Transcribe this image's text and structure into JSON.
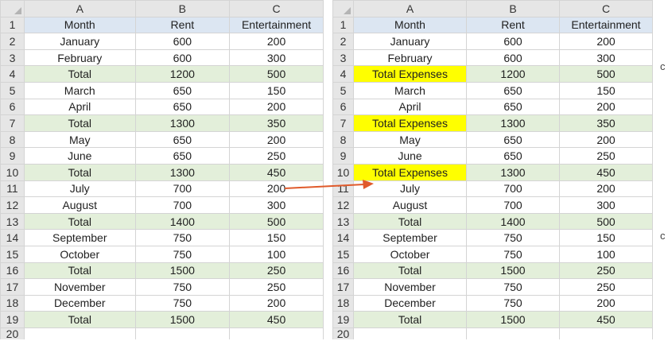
{
  "columns": [
    "A",
    "B",
    "C"
  ],
  "left_sheet": {
    "rows": [
      {
        "num": "1",
        "a": "Month",
        "b": "Rent",
        "c": "Entertainment",
        "kind": "header"
      },
      {
        "num": "2",
        "a": "January",
        "b": "600",
        "c": "200",
        "kind": "data"
      },
      {
        "num": "3",
        "a": "February",
        "b": "600",
        "c": "300",
        "kind": "data"
      },
      {
        "num": "4",
        "a": "Total",
        "b": "1200",
        "c": "500",
        "kind": "total"
      },
      {
        "num": "5",
        "a": "March",
        "b": "650",
        "c": "150",
        "kind": "data"
      },
      {
        "num": "6",
        "a": "April",
        "b": "650",
        "c": "200",
        "kind": "data"
      },
      {
        "num": "7",
        "a": "Total",
        "b": "1300",
        "c": "350",
        "kind": "total"
      },
      {
        "num": "8",
        "a": "May",
        "b": "650",
        "c": "200",
        "kind": "data"
      },
      {
        "num": "9",
        "a": "June",
        "b": "650",
        "c": "250",
        "kind": "data"
      },
      {
        "num": "10",
        "a": "Total",
        "b": "1300",
        "c": "450",
        "kind": "total"
      },
      {
        "num": "11",
        "a": "July",
        "b": "700",
        "c": "200",
        "kind": "data"
      },
      {
        "num": "12",
        "a": "August",
        "b": "700",
        "c": "300",
        "kind": "data"
      },
      {
        "num": "13",
        "a": "Total",
        "b": "1400",
        "c": "500",
        "kind": "total"
      },
      {
        "num": "14",
        "a": "September",
        "b": "750",
        "c": "150",
        "kind": "data"
      },
      {
        "num": "15",
        "a": "October",
        "b": "750",
        "c": "100",
        "kind": "data"
      },
      {
        "num": "16",
        "a": "Total",
        "b": "1500",
        "c": "250",
        "kind": "total"
      },
      {
        "num": "17",
        "a": "November",
        "b": "750",
        "c": "250",
        "kind": "data"
      },
      {
        "num": "18",
        "a": "December",
        "b": "750",
        "c": "200",
        "kind": "data"
      },
      {
        "num": "19",
        "a": "Total",
        "b": "1500",
        "c": "450",
        "kind": "total"
      }
    ],
    "partial_row": "20"
  },
  "right_sheet": {
    "rows": [
      {
        "num": "1",
        "a": "Month",
        "b": "Rent",
        "c": "Entertainment",
        "kind": "header"
      },
      {
        "num": "2",
        "a": "January",
        "b": "600",
        "c": "200",
        "kind": "data"
      },
      {
        "num": "3",
        "a": "February",
        "b": "600",
        "c": "300",
        "kind": "data"
      },
      {
        "num": "4",
        "a": "Total Expenses",
        "b": "1200",
        "c": "500",
        "kind": "total",
        "highlight": true
      },
      {
        "num": "5",
        "a": "March",
        "b": "650",
        "c": "150",
        "kind": "data"
      },
      {
        "num": "6",
        "a": "April",
        "b": "650",
        "c": "200",
        "kind": "data"
      },
      {
        "num": "7",
        "a": "Total Expenses",
        "b": "1300",
        "c": "350",
        "kind": "total",
        "highlight": true
      },
      {
        "num": "8",
        "a": "May",
        "b": "650",
        "c": "200",
        "kind": "data"
      },
      {
        "num": "9",
        "a": "June",
        "b": "650",
        "c": "250",
        "kind": "data"
      },
      {
        "num": "10",
        "a": "Total Expenses",
        "b": "1300",
        "c": "450",
        "kind": "total",
        "highlight": true
      },
      {
        "num": "11",
        "a": "July",
        "b": "700",
        "c": "200",
        "kind": "data"
      },
      {
        "num": "12",
        "a": "August",
        "b": "700",
        "c": "300",
        "kind": "data"
      },
      {
        "num": "13",
        "a": "Total",
        "b": "1400",
        "c": "500",
        "kind": "total"
      },
      {
        "num": "14",
        "a": "September",
        "b": "750",
        "c": "150",
        "kind": "data"
      },
      {
        "num": "15",
        "a": "October",
        "b": "750",
        "c": "100",
        "kind": "data"
      },
      {
        "num": "16",
        "a": "Total",
        "b": "1500",
        "c": "250",
        "kind": "total"
      },
      {
        "num": "17",
        "a": "November",
        "b": "750",
        "c": "250",
        "kind": "data"
      },
      {
        "num": "18",
        "a": "December",
        "b": "750",
        "c": "200",
        "kind": "data"
      },
      {
        "num": "19",
        "a": "Total",
        "b": "1500",
        "c": "450",
        "kind": "total"
      }
    ],
    "partial_row": "20"
  },
  "edge_stubs": [
    "c",
    "c"
  ],
  "colors": {
    "header_fill": "#dce6f2",
    "total_fill": "#e3efda",
    "highlight_fill": "#ffff00",
    "arrow": "#e05a2b",
    "grid_line": "#d4d4d4",
    "headings_fill": "#e6e6e6"
  },
  "icons": {
    "select_all_corner": "triangle-corner-icon",
    "transition_arrow": "arrow-right-icon"
  }
}
